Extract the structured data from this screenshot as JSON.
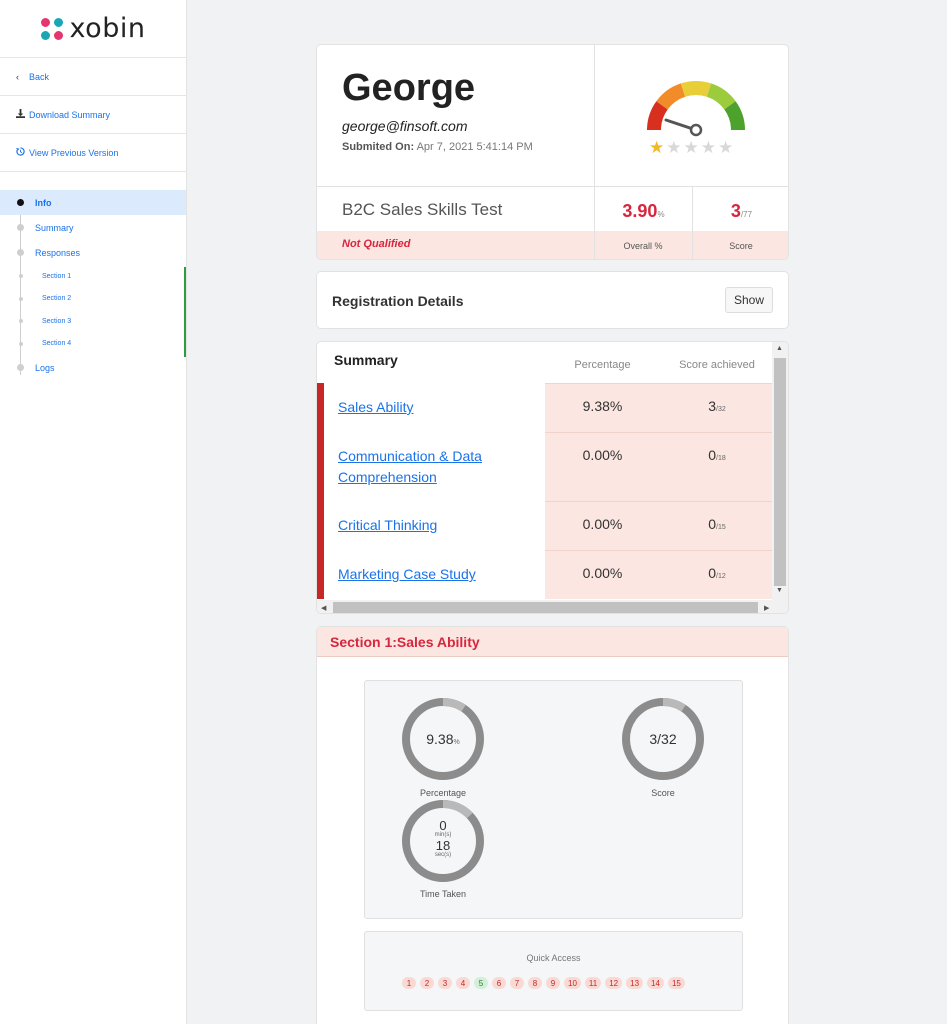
{
  "brand": {
    "name": "xobin"
  },
  "sidebar": {
    "back": "Back",
    "download": "Download Summary",
    "previous": "View Previous Version",
    "nav": [
      {
        "label": "Info"
      },
      {
        "label": "Summary"
      },
      {
        "label": "Responses"
      },
      {
        "label": "Section 1"
      },
      {
        "label": "Section 2"
      },
      {
        "label": "Section 3"
      },
      {
        "label": "Section 4"
      },
      {
        "label": "Logs"
      }
    ]
  },
  "candidate": {
    "name": "George",
    "email": "george@finsoft.com",
    "submitted_label": "Submited On:",
    "submitted_value": "Apr 7, 2021 5:41:14 PM",
    "rating": 1,
    "rating_max": 5
  },
  "test": {
    "name": "B2C Sales Skills Test",
    "status": "Not Qualified",
    "overall_value": "3.90",
    "overall_unit": "%",
    "overall_label": "Overall %",
    "score_value": "3",
    "score_total": "/77",
    "score_label": "Score"
  },
  "registration": {
    "title": "Registration Details",
    "button": "Show"
  },
  "summary": {
    "title": "Summary",
    "col_percentage": "Percentage",
    "col_score": "Score achieved",
    "rows": [
      {
        "section": "Sales Ability",
        "percentage": "9.38%",
        "score": "3",
        "total": "/32"
      },
      {
        "section": "Communication & Data Comprehension",
        "percentage": "0.00%",
        "score": "0",
        "total": "/18"
      },
      {
        "section": "Critical Thinking",
        "percentage": "0.00%",
        "score": "0",
        "total": "/15"
      },
      {
        "section": "Marketing Case Study",
        "percentage": "0.00%",
        "score": "0",
        "total": "/12"
      }
    ]
  },
  "section1": {
    "title": "Section 1:Sales Ability",
    "percentage_value": "9.38",
    "percentage_unit": "%",
    "percentage_fraction": 0.0938,
    "percentage_label": "Percentage",
    "score_value": "3/32",
    "score_fraction": 0.09375,
    "score_label": "Score",
    "time_min": "0",
    "time_min_unit": "min(s)",
    "time_sec": "18",
    "time_sec_unit": "sec(s)",
    "time_label": "Time Taken",
    "quick_access_title": "Quick Access",
    "quick_access": [
      {
        "n": "1",
        "state": "wrong"
      },
      {
        "n": "2",
        "state": "wrong"
      },
      {
        "n": "3",
        "state": "wrong"
      },
      {
        "n": "4",
        "state": "wrong"
      },
      {
        "n": "5",
        "state": "correct"
      },
      {
        "n": "6",
        "state": "wrong"
      },
      {
        "n": "7",
        "state": "wrong"
      },
      {
        "n": "8",
        "state": "wrong"
      },
      {
        "n": "9",
        "state": "wrong"
      },
      {
        "n": "10",
        "state": "wrong"
      },
      {
        "n": "11",
        "state": "wrong"
      },
      {
        "n": "12",
        "state": "wrong"
      },
      {
        "n": "13",
        "state": "wrong"
      },
      {
        "n": "14",
        "state": "wrong"
      },
      {
        "n": "15",
        "state": "wrong"
      }
    ]
  },
  "colors": {
    "accent": "#1a73e8",
    "danger": "#d7263d",
    "pink_bg": "#fbe6e1",
    "gauge": [
      "#d7301f",
      "#f28c28",
      "#e8cf3a",
      "#9ccc3c",
      "#4ca22c"
    ]
  }
}
